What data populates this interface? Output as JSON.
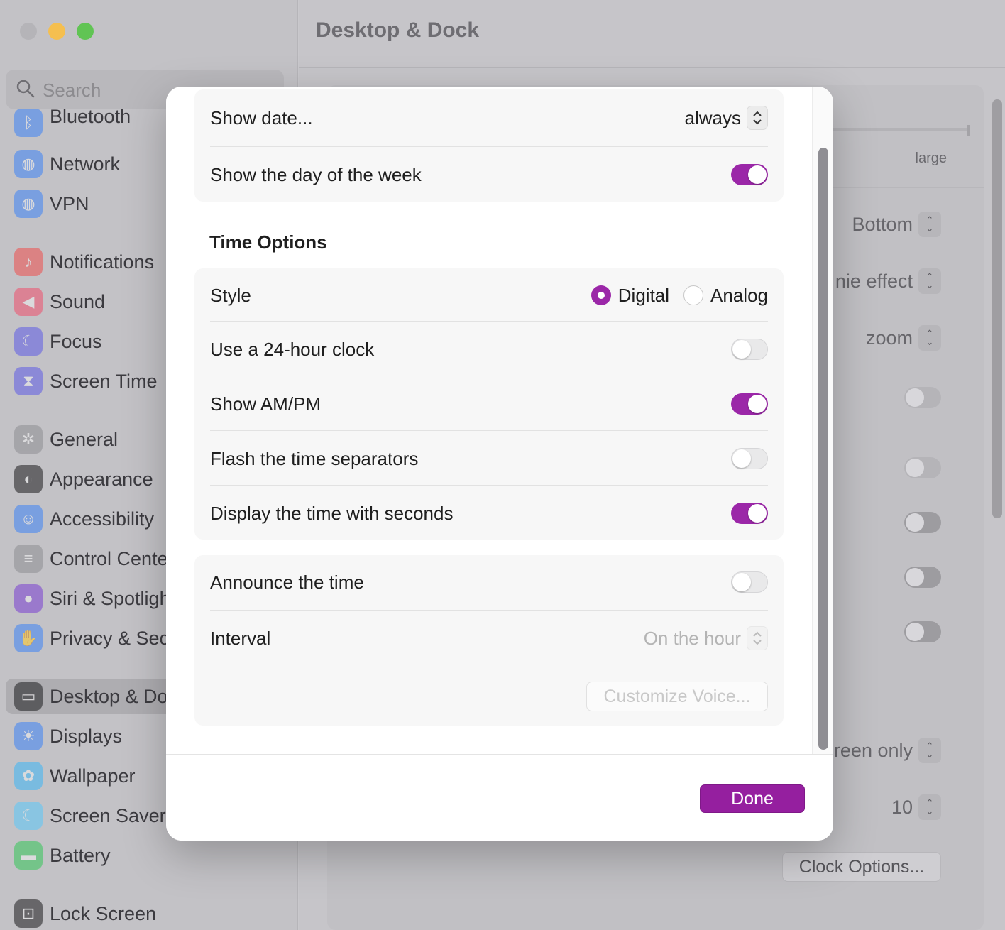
{
  "window": {
    "title": "Desktop & Dock",
    "traffic_colors": [
      "#b5b4b8",
      "#f5bf4f",
      "#61c454"
    ]
  },
  "search": {
    "placeholder": "Search"
  },
  "sidebar": {
    "items": [
      {
        "label": "Bluetooth",
        "icon": "bluetooth-icon",
        "color": "#3e83f7"
      },
      {
        "label": "Network",
        "icon": "network-globe-icon",
        "color": "#3e83f7"
      },
      {
        "label": "VPN",
        "icon": "vpn-globe-icon",
        "color": "#3e83f7"
      },
      {
        "label": "Notifications",
        "icon": "bell-icon",
        "color": "#ef4e4e"
      },
      {
        "label": "Sound",
        "icon": "speaker-icon",
        "color": "#ef4e6c"
      },
      {
        "label": "Focus",
        "icon": "moon-icon",
        "color": "#5e5ce6"
      },
      {
        "label": "Screen Time",
        "icon": "hourglass-icon",
        "color": "#5e5ce6"
      },
      {
        "label": "General",
        "icon": "gear-icon",
        "color": "#8e8e93"
      },
      {
        "label": "Appearance",
        "icon": "appearance-icon",
        "color": "#1c1c1e"
      },
      {
        "label": "Accessibility",
        "icon": "accessibility-icon",
        "color": "#3e83f7"
      },
      {
        "label": "Control Cente",
        "icon": "control-center-icon",
        "color": "#8e8e93"
      },
      {
        "label": "Siri & Spotligh",
        "icon": "siri-icon",
        "color": "#7a3ed1"
      },
      {
        "label": "Privacy & Sec",
        "icon": "hand-icon",
        "color": "#3e83f7"
      },
      {
        "label": "Desktop & Do",
        "icon": "dock-icon",
        "color": "#1c1c1e"
      },
      {
        "label": "Displays",
        "icon": "sun-icon",
        "color": "#3e83f7"
      },
      {
        "label": "Wallpaper",
        "icon": "flower-icon",
        "color": "#3eb6f7"
      },
      {
        "label": "Screen Saver",
        "icon": "screensaver-icon",
        "color": "#5ac8fa"
      },
      {
        "label": "Battery",
        "icon": "battery-icon",
        "color": "#34c759"
      },
      {
        "label": "Lock Screen",
        "icon": "lock-icon",
        "color": "#1c1c1e"
      }
    ]
  },
  "background": {
    "size_max_label": "large",
    "position_value": "Bottom",
    "minimize_value": "nie effect",
    "double_click_value": "zoom",
    "stage_manager_value": "reen only",
    "recent_apps_value": "10",
    "clock_options_label": "Clock Options..."
  },
  "dialog": {
    "date_group": {
      "show_date_label": "Show date...",
      "show_date_value": "always",
      "day_of_week_label": "Show the day of the week",
      "day_of_week_on": true
    },
    "time_options_title": "Time Options",
    "time_group": {
      "style_label": "Style",
      "style_options": [
        "Digital",
        "Analog"
      ],
      "style_selected": "Digital",
      "rows": [
        {
          "label": "Use a 24-hour clock",
          "on": false
        },
        {
          "label": "Show AM/PM",
          "on": true
        },
        {
          "label": "Flash the time separators",
          "on": false
        },
        {
          "label": "Display the time with seconds",
          "on": true
        }
      ]
    },
    "announce_group": {
      "announce_label": "Announce the time",
      "announce_on": false,
      "interval_label": "Interval",
      "interval_value": "On the hour",
      "customize_voice_label": "Customize Voice..."
    },
    "done_label": "Done"
  },
  "colors": {
    "accent": "#9b27a8",
    "done_button": "#951f9f"
  }
}
